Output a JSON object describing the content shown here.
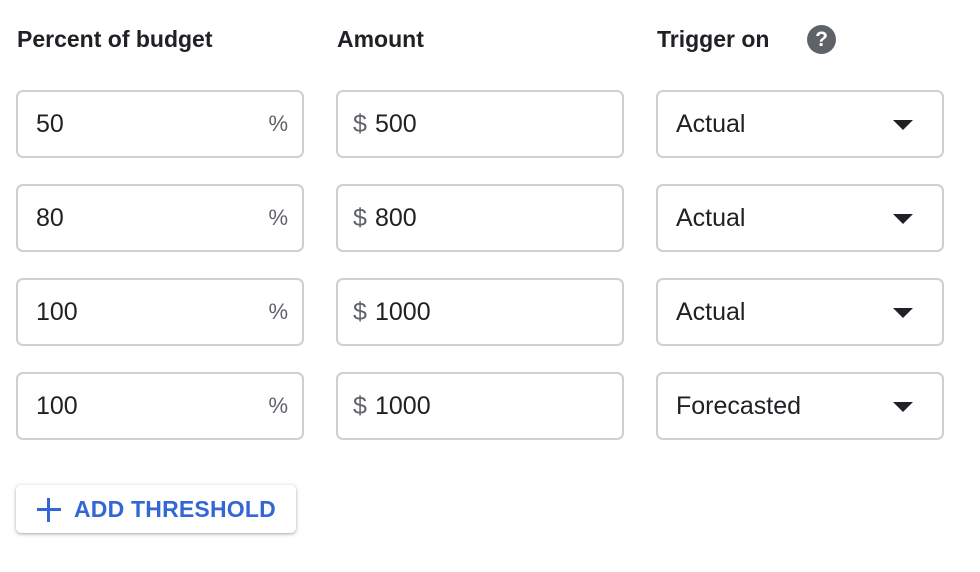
{
  "headers": {
    "percent": "Percent of budget",
    "amount": "Amount",
    "trigger": "Trigger on",
    "help_icon": "?"
  },
  "thresholds": [
    {
      "percent": "50",
      "percent_suffix": "%",
      "currency": "$",
      "amount": "500",
      "trigger": "Actual"
    },
    {
      "percent": "80",
      "percent_suffix": "%",
      "currency": "$",
      "amount": "800",
      "trigger": "Actual"
    },
    {
      "percent": "100",
      "percent_suffix": "%",
      "currency": "$",
      "amount": "1000",
      "trigger": "Actual"
    },
    {
      "percent": "100",
      "percent_suffix": "%",
      "currency": "$",
      "amount": "1000",
      "trigger": "Forecasted"
    }
  ],
  "add_button": {
    "icon": "plus-icon",
    "label": "ADD THRESHOLD"
  },
  "colors": {
    "accent": "#3367d6",
    "border": "#cfcfcf",
    "icon_gray": "#5f6368",
    "text": "#202124"
  }
}
